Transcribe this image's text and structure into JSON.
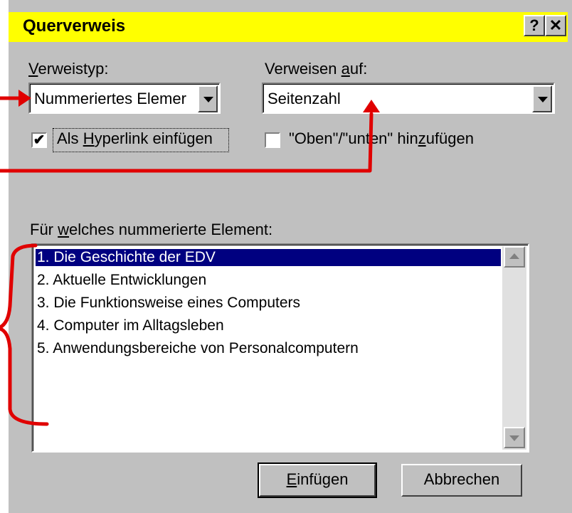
{
  "dialog": {
    "title": "Querverweis",
    "help_label": "?",
    "close_label": "✕"
  },
  "verweistyp": {
    "label_first": "V",
    "label_rest": "erweistyp:",
    "value": "Nummeriertes Elemer"
  },
  "verweisen_auf": {
    "label_pre": "Verweisen ",
    "label_u": "a",
    "label_post": "uf:",
    "value": "Seitenzahl"
  },
  "hyperlink_checkbox": {
    "checked": true,
    "mark": "✔",
    "label_pre": "Als ",
    "label_u": "H",
    "label_post": "yperlink einfügen"
  },
  "oben_unten_checkbox": {
    "checked": false,
    "label_pre": "\"Oben\"/\"unten\" hin",
    "label_u": "z",
    "label_post": "ufügen"
  },
  "element_list": {
    "label_pre": "Für ",
    "label_u": "w",
    "label_post": "elches nummerierte Element:",
    "items": [
      "1. Die Geschichte der EDV",
      "2. Aktuelle Entwicklungen",
      "3. Die Funktionsweise eines Computers",
      "4. Computer im Alltagsleben",
      "5. Anwendungsbereiche von Personalcomputern"
    ],
    "selected_index": 0
  },
  "buttons": {
    "insert_u": "E",
    "insert_rest": "infügen",
    "cancel": "Abbrechen"
  },
  "colors": {
    "title_bg": "#ffff00",
    "dialog_bg": "#c0c0c0",
    "selection": "#000080",
    "annotation": "#e00000"
  }
}
